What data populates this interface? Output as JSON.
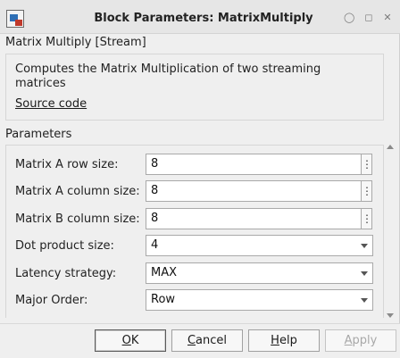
{
  "window": {
    "title": "Block Parameters: MatrixMultiply",
    "icons": {
      "app": "simulink-block-icon",
      "restore": "pin-icon",
      "maximize": "maximize-icon",
      "close": "close-icon"
    }
  },
  "block": {
    "heading": "Matrix Multiply [Stream]",
    "description": "Computes the Matrix Multiplication of two streaming matrices",
    "source_link": "Source code"
  },
  "parameters": {
    "label": "Parameters",
    "fields": [
      {
        "label": "Matrix A row size:",
        "value": "8",
        "type": "edit"
      },
      {
        "label": "Matrix A column size:",
        "value": "8",
        "type": "edit"
      },
      {
        "label": "Matrix B column size:",
        "value": "8",
        "type": "edit"
      },
      {
        "label": "Dot product size:",
        "value": "4",
        "type": "dropdown"
      },
      {
        "label": "Latency strategy:",
        "value": "MAX",
        "type": "dropdown"
      },
      {
        "label": "Major Order:",
        "value": "Row",
        "type": "dropdown"
      }
    ],
    "kebab_glyph": "⋮"
  },
  "buttons": {
    "ok": {
      "first": "O",
      "rest": "K"
    },
    "cancel": {
      "first": "C",
      "rest": "ancel"
    },
    "help": {
      "first": "H",
      "rest": "elp"
    },
    "apply": {
      "first": "A",
      "rest": "pply"
    }
  },
  "colors": {
    "dialog_bg": "#efefef",
    "field_bg": "#ffffff",
    "disabled_text": "#a8a8a8"
  }
}
